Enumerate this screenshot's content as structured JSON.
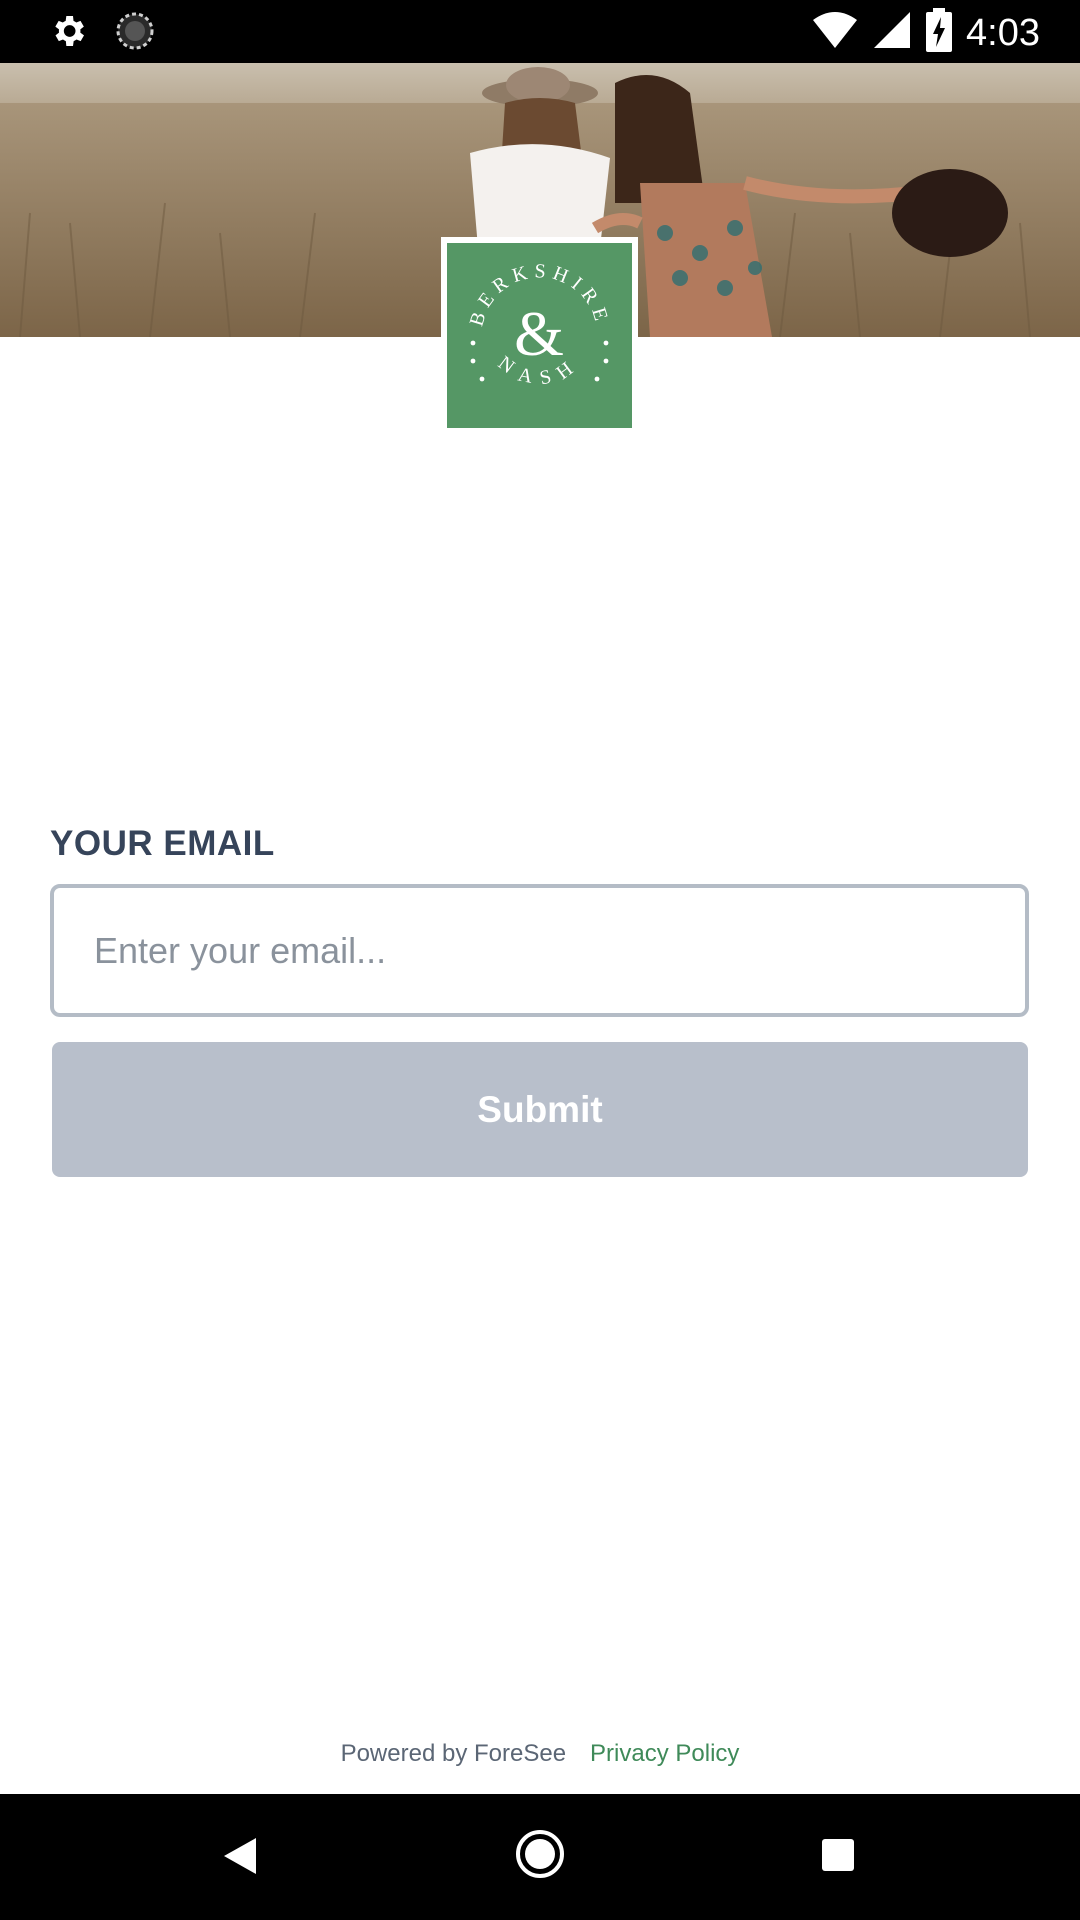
{
  "status_bar": {
    "time": "4:03",
    "icons": [
      "settings-gear-icon",
      "sync-circle-icon",
      "wifi-icon",
      "cell-signal-icon",
      "battery-charging-icon"
    ]
  },
  "hero": {
    "description_icon": "hero-photo-field-image"
  },
  "logo": {
    "brand_top": "BERKSHIRE",
    "brand_mid": "&",
    "brand_bottom": "NASH",
    "color": "#559765"
  },
  "form": {
    "email_label": "YOUR EMAIL",
    "email_placeholder": "Enter your email...",
    "email_value": "",
    "submit_label": "Submit",
    "submit_color": "#b8bfcb"
  },
  "footer": {
    "powered_by": "Powered by ForeSee",
    "privacy_policy": "Privacy Policy",
    "privacy_color": "#3f8a59"
  },
  "nav_bar": {
    "icons": [
      "back-icon",
      "home-icon",
      "recents-icon"
    ]
  }
}
